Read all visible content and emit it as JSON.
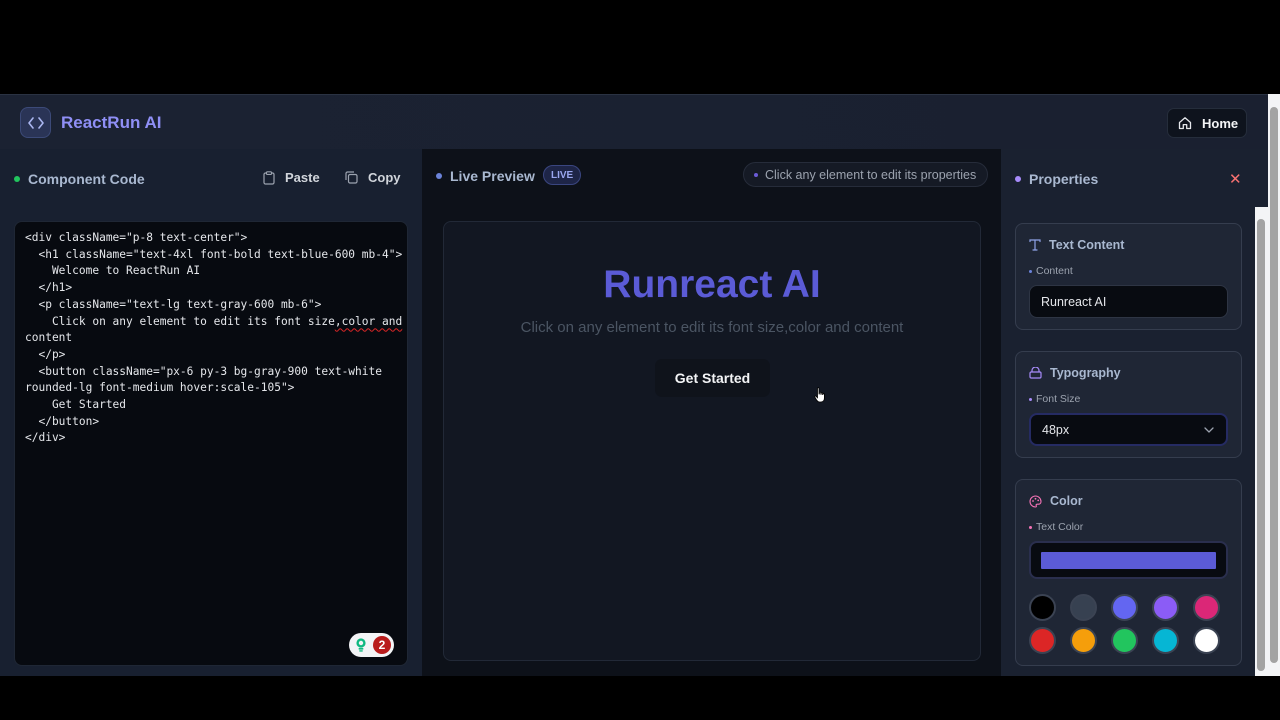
{
  "header": {
    "logo_icon": "code-brackets-icon",
    "app_name": "ReactRun AI",
    "home_label": "Home"
  },
  "code_panel": {
    "title": "Component Code",
    "paste_label": "Paste",
    "copy_label": "Copy",
    "lines": [
      "<div className=\"p-8 text-center\">",
      "  <h1 className=\"text-4xl font-bold text-blue-600 mb-4\">",
      "    Welcome to ReactRun AI",
      "  </h1>",
      "  <p className=\"text-lg text-gray-600 mb-6\">",
      "    Click on any element to edit its font size",
      "content",
      "  </p>",
      "  <button className=\"px-6 py-3 bg-gray-900 text-white",
      "rounded-lg font-medium hover:scale-105\">",
      "    Get Started",
      "  </button>",
      "</div>"
    ],
    "squiggle_text": ",color and",
    "badge_count": "2"
  },
  "preview_panel": {
    "title": "Live Preview",
    "live_badge": "LIVE",
    "hint": "Click any element to edit its properties",
    "heading": "Runreact AI",
    "paragraph": "Click on any element to edit its font size,color and content",
    "button_label": "Get Started"
  },
  "properties_panel": {
    "title": "Properties",
    "close_icon": "close-icon",
    "text_content": {
      "title": "Text Content",
      "label": "Content",
      "value": "Runreact AI"
    },
    "typography": {
      "title": "Typography",
      "label": "Font Size",
      "value": "48px"
    },
    "color": {
      "title": "Color",
      "label": "Text Color",
      "current": "#5b5bd6",
      "palette": [
        "#000000",
        "#374151",
        "#6366f1",
        "#8b5cf6",
        "#db2777",
        "#dc2626",
        "#f59e0b",
        "#22c55e",
        "#06b6d4",
        "#ffffff"
      ]
    }
  },
  "colors": {
    "accent": "#5b5bd6",
    "green_dot": "#22c55e",
    "blue_dot": "#6b83d9",
    "purple_dot": "#a78bfa"
  }
}
